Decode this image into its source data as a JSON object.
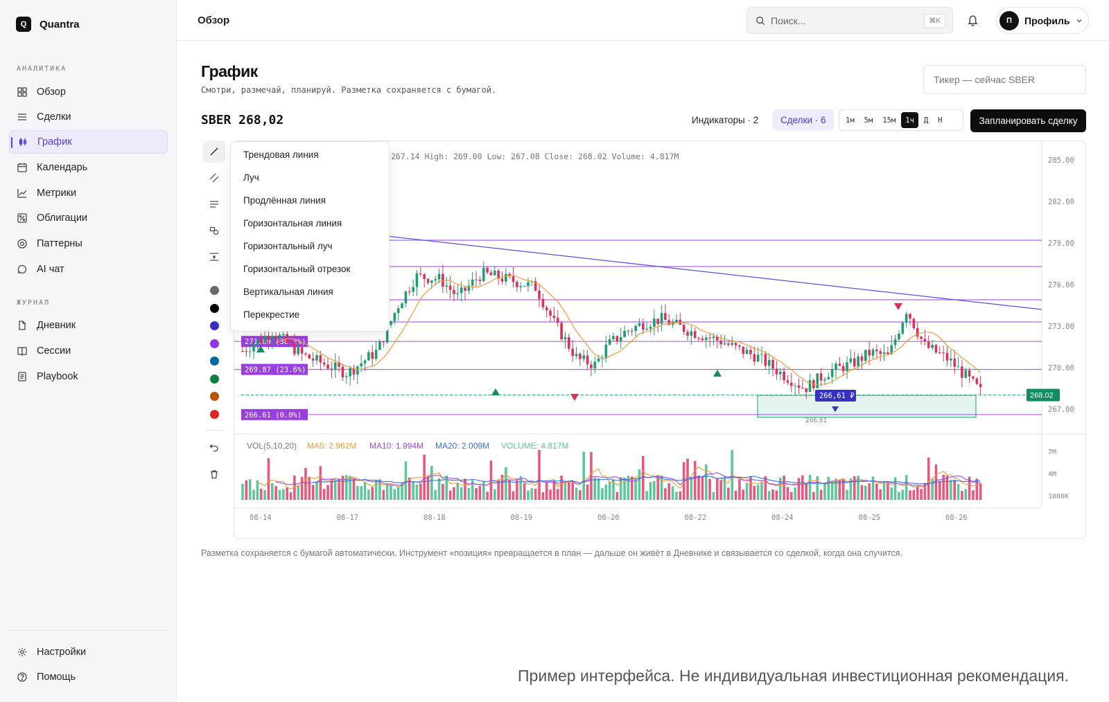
{
  "app": {
    "name": "Quantra",
    "logo_letter": "Q"
  },
  "sidebar": {
    "sections": [
      {
        "title": "АНАЛИТИКА",
        "items": [
          {
            "label": "Обзор",
            "icon": "grid-icon"
          },
          {
            "label": "Сделки",
            "icon": "list-icon"
          },
          {
            "label": "График",
            "icon": "candles-icon",
            "active": true
          },
          {
            "label": "Календарь",
            "icon": "calendar-icon"
          },
          {
            "label": "Метрики",
            "icon": "line-chart-icon"
          },
          {
            "label": "Облигации",
            "icon": "bond-icon"
          },
          {
            "label": "Паттерны",
            "icon": "target-icon"
          },
          {
            "label": "AI чат",
            "icon": "chat-icon"
          }
        ]
      },
      {
        "title": "ЖУРНАЛ",
        "items": [
          {
            "label": "Дневник",
            "icon": "file-icon"
          },
          {
            "label": "Сессии",
            "icon": "book-icon"
          },
          {
            "label": "Playbook",
            "icon": "playbook-icon"
          }
        ]
      }
    ],
    "bottom": [
      {
        "label": "Настройки",
        "icon": "gear-icon"
      },
      {
        "label": "Помощь",
        "icon": "help-icon"
      }
    ]
  },
  "topbar": {
    "breadcrumb": "Обзор",
    "search_placeholder": "Поиск...",
    "search_shortcut": "⌘K",
    "profile_initial": "П",
    "profile_label": "Профиль"
  },
  "page": {
    "title": "График",
    "subtitle": "Смотри, размечай, планируй. Разметка сохраняется с бумагой.",
    "ticker_placeholder": "Тикер — сейчас SBER",
    "quote": "SBER 268,02"
  },
  "toolbar": {
    "indicators_label": "Индикаторы · 2",
    "deals_label": "Сделки · 6",
    "timeframes": [
      "1м",
      "5м",
      "15м",
      "1ч",
      "Д",
      "Н"
    ],
    "active_timeframe": "1ч",
    "plan_label": "Запланировать сделку"
  },
  "drawing_tools": {
    "tools": [
      "trend-line-icon",
      "parallel-lines-icon",
      "horizontal-lines-icon",
      "shapes-icon",
      "fib-icon"
    ],
    "colors": [
      "#6b6b6b",
      "#000000",
      "#3730c4",
      "#9333ea",
      "#0369a1",
      "#15803d",
      "#b45309",
      "#dc2626"
    ],
    "menu_items": [
      "Трендовая линия",
      "Луч",
      "Продлённая линия",
      "Горизонтальная линия",
      "Горизонтальный луч",
      "Горизонтальный отрезок",
      "Вертикальная линия",
      "Перекрестие"
    ]
  },
  "chart": {
    "ohlc_text": "267.14  High: 269.00  Low: 267.08  Close: 268.02  Volume: 4.817M",
    "price_ticks": [
      "285.00",
      "282.00",
      "279.00",
      "276.00",
      "273.00",
      "270.00",
      "267.00"
    ],
    "x_ticks": [
      "08-14",
      "08-17",
      "08-18",
      "08-19",
      "08-20",
      "08-22",
      "08-24",
      "08-25",
      "08-26"
    ],
    "last_price_label": "268.02",
    "fib_labels": [
      "271.89 (38.2%)",
      "269.87 (23.6%)",
      "266.61 (0.0%)"
    ],
    "position_label": "266,61 ₽",
    "position_sub": "266.61",
    "volume_ticks": [
      "7M",
      "4M",
      "1000K"
    ],
    "volume_legend": {
      "title": "VOL(5,10,20)",
      "ma5": "MA5: 2.962M",
      "ma10": "MA10: 1.994M",
      "ma20": "MA20: 2.009M",
      "volume": "VOLUME: 4.817M"
    },
    "colors": {
      "up": "#1f9d6f",
      "down": "#d8335a",
      "ma": "#f0a03c",
      "fib": "#9b4ddb",
      "trend": "#5a4fd6"
    }
  },
  "footer_note": "Разметка сохраняется с бумагой автоматически. Инструмент «позиция» превращается в план — дальше он живёт в Дневнике и связывается со сделкой, когда она случится.",
  "disclaimer": "Пример интерфейса. Не индивидуальная инвестиционная рекомендация."
}
